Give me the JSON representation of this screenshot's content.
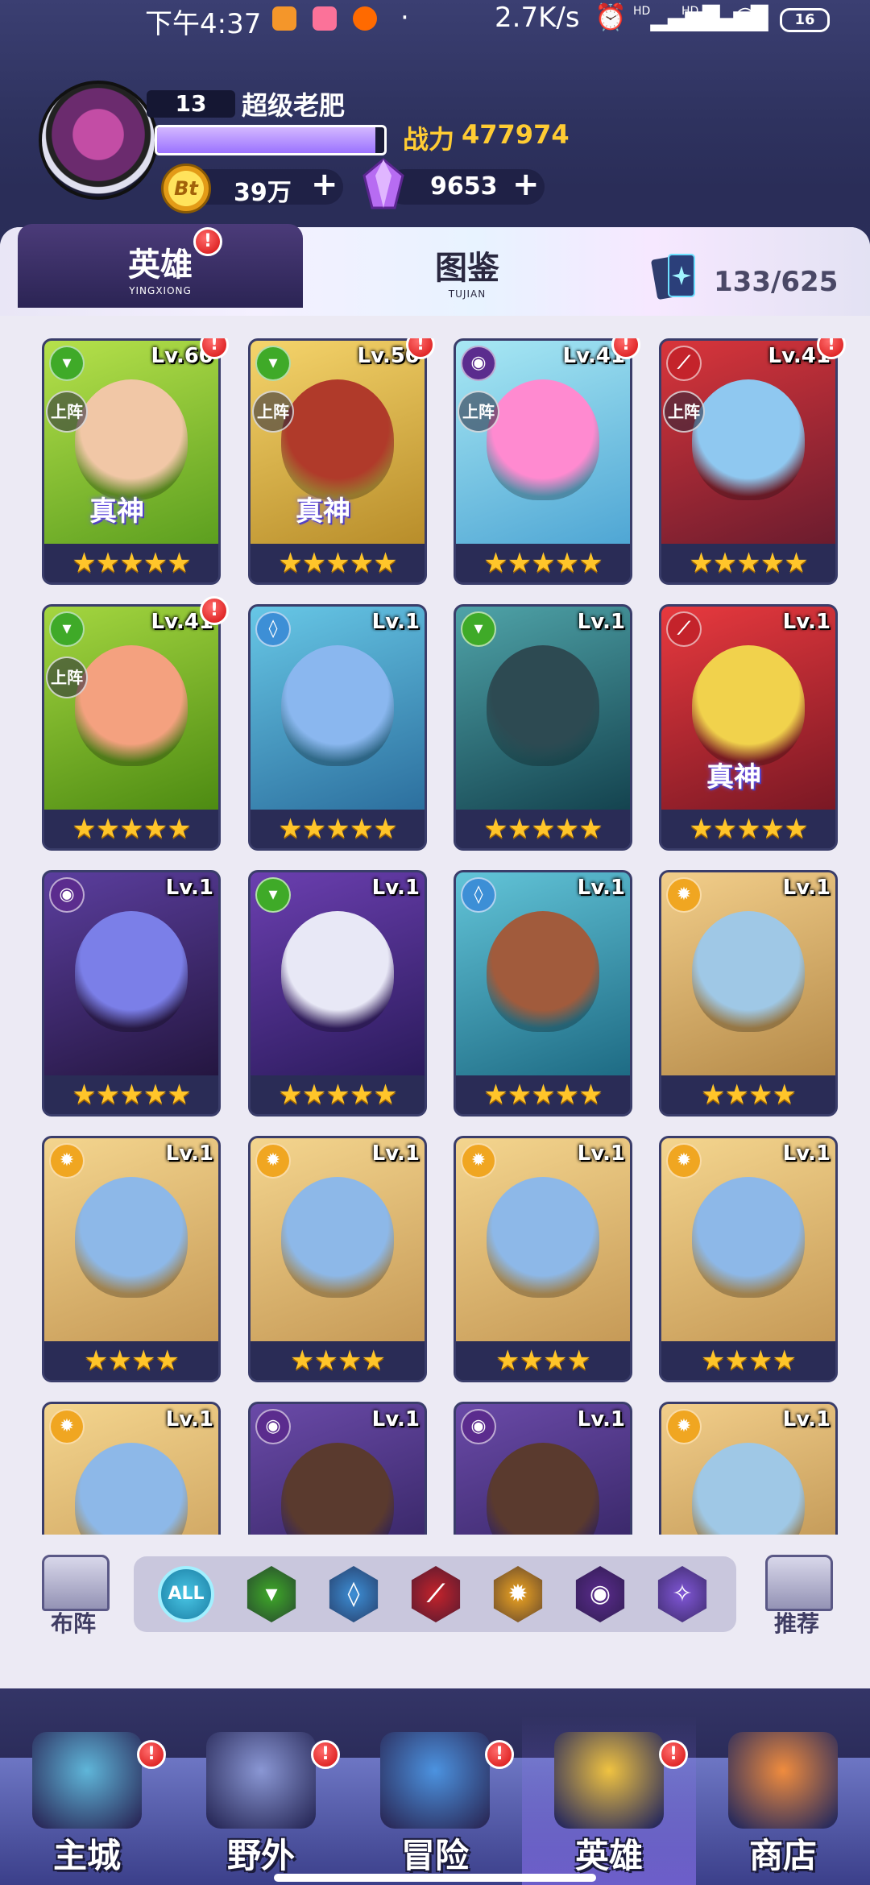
{
  "status_bar": {
    "time": "下午4:37",
    "net_speed": "2.7K/s",
    "signal1": "HD",
    "signal2": "HD",
    "battery": "16"
  },
  "player": {
    "level": "13",
    "name": "超级老肥",
    "xp_fraction": 0.96,
    "power_label": "战力",
    "power_value": "477974",
    "gold": "39万",
    "gold_coin_text": "Bt",
    "gems": "9653",
    "plus": "+"
  },
  "tabs": {
    "heroes": {
      "label": "英雄",
      "sub": "YINGXIONG"
    },
    "codex": {
      "label": "图鉴",
      "sub": "TUJIAN"
    },
    "collection": "133/625",
    "badge": "!"
  },
  "hero_labels": {
    "deployed": "上阵",
    "true_god": "真神"
  },
  "heroes": [
    {
      "level": "Lv.60",
      "stars": "★★★★★",
      "element": "nature",
      "deployed": true,
      "true_god": true,
      "badge": true,
      "colors": [
        "#b6e14b",
        "#5c9f1f"
      ],
      "skin": "#f1c7a6"
    },
    {
      "level": "Lv.50",
      "stars": "★★★★★",
      "element": "nature",
      "deployed": true,
      "true_god": true,
      "badge": true,
      "colors": [
        "#f5d46b",
        "#b88d2a"
      ],
      "skin": "#b03a2a"
    },
    {
      "level": "Lv.41",
      "stars": "★★★★★",
      "element": "dark",
      "deployed": true,
      "true_god": false,
      "badge": true,
      "colors": [
        "#a8e8f4",
        "#4fa6d4"
      ],
      "skin": "#ff8ad0"
    },
    {
      "level": "Lv.41",
      "stars": "★★★★★",
      "element": "fire",
      "deployed": true,
      "true_god": false,
      "badge": true,
      "colors": [
        "#d9353b",
        "#6b1c2e"
      ],
      "skin": "#8fc8f0"
    },
    {
      "level": "Lv.41",
      "stars": "★★★★★",
      "element": "nature",
      "deployed": true,
      "true_god": false,
      "badge": true,
      "colors": [
        "#a4d640",
        "#4d8b12"
      ],
      "skin": "#f4a17f"
    },
    {
      "level": "Lv.1",
      "stars": "★★★★★",
      "element": "water",
      "deployed": false,
      "true_god": false,
      "badge": false,
      "colors": [
        "#67c7e6",
        "#2c6f9e"
      ],
      "skin": "#8ab7ef"
    },
    {
      "level": "Lv.1",
      "stars": "★★★★★",
      "element": "nature",
      "deployed": false,
      "true_god": false,
      "badge": false,
      "colors": [
        "#4fa3a8",
        "#14434f"
      ],
      "skin": "#2d4a52"
    },
    {
      "level": "Lv.1",
      "stars": "★★★★★",
      "element": "fire",
      "deployed": false,
      "true_god": true,
      "badge": false,
      "colors": [
        "#e8393e",
        "#7a1824"
      ],
      "skin": "#f1d24c"
    },
    {
      "level": "Lv.1",
      "stars": "★★★★★",
      "element": "dark",
      "deployed": false,
      "true_god": false,
      "badge": false,
      "colors": [
        "#5b3e9e",
        "#241640"
      ],
      "skin": "#7b7fe8"
    },
    {
      "level": "Lv.1",
      "stars": "★★★★★",
      "element": "nature",
      "deployed": false,
      "true_god": false,
      "badge": false,
      "colors": [
        "#6b3fb0",
        "#2b1b5c"
      ],
      "skin": "#e8e8f6"
    },
    {
      "level": "Lv.1",
      "stars": "★★★★★",
      "element": "water",
      "deployed": false,
      "true_god": false,
      "badge": false,
      "colors": [
        "#62c4d8",
        "#1e6b84"
      ],
      "skin": "#a15b3c"
    },
    {
      "level": "Lv.1",
      "stars": "★★★★",
      "element": "light",
      "deployed": false,
      "true_god": false,
      "badge": false,
      "colors": [
        "#f2ce8a",
        "#b58a49"
      ],
      "skin": "#9fc8e6"
    },
    {
      "level": "Lv.1",
      "stars": "★★★★",
      "element": "light",
      "deployed": false,
      "true_god": false,
      "badge": false,
      "colors": [
        "#f4d58e",
        "#c69a57"
      ],
      "skin": "#8db8e8"
    },
    {
      "level": "Lv.1",
      "stars": "★★★★",
      "element": "light",
      "deployed": false,
      "true_god": false,
      "badge": false,
      "colors": [
        "#f4d58e",
        "#c69a57"
      ],
      "skin": "#8db8e8"
    },
    {
      "level": "Lv.1",
      "stars": "★★★★",
      "element": "light",
      "deployed": false,
      "true_god": false,
      "badge": false,
      "colors": [
        "#f4d58e",
        "#c69a57"
      ],
      "skin": "#8db8e8"
    },
    {
      "level": "Lv.1",
      "stars": "★★★★",
      "element": "light",
      "deployed": false,
      "true_god": false,
      "badge": false,
      "colors": [
        "#f4d58e",
        "#c69a57"
      ],
      "skin": "#8db8e8"
    },
    {
      "level": "Lv.1",
      "stars": "★★★★",
      "element": "light",
      "deployed": false,
      "true_god": false,
      "badge": false,
      "colors": [
        "#f4d58e",
        "#c69a57"
      ],
      "skin": "#8db8e8"
    },
    {
      "level": "Lv.1",
      "stars": "★★★★",
      "element": "dark",
      "deployed": false,
      "true_god": false,
      "badge": false,
      "colors": [
        "#6a4aa8",
        "#2a1d55"
      ],
      "skin": "#5a3a2e"
    },
    {
      "level": "Lv.1",
      "stars": "★★★★",
      "element": "dark",
      "deployed": false,
      "true_god": false,
      "badge": false,
      "colors": [
        "#6a4aa8",
        "#2a1d55"
      ],
      "skin": "#5a3a2e"
    },
    {
      "level": "Lv.1",
      "stars": "★★★★",
      "element": "light",
      "deployed": false,
      "true_god": false,
      "badge": false,
      "colors": [
        "#f2ce8a",
        "#b58a49"
      ],
      "skin": "#9fc8e6"
    }
  ],
  "elements": {
    "nature": {
      "color": "#3faa28",
      "glyph": "▾",
      "icon": "leaf-icon"
    },
    "water": {
      "color": "#3d8fd6",
      "glyph": "◊",
      "icon": "water-drop-icon"
    },
    "fire": {
      "color": "#c4232b",
      "glyph": "⟋",
      "icon": "claw-icon"
    },
    "light": {
      "color": "#f0a621",
      "glyph": "✹",
      "icon": "sun-icon"
    },
    "dark": {
      "color": "#5b2c8e",
      "glyph": "◉",
      "icon": "eye-icon"
    },
    "arcane": {
      "color": "#8157d8",
      "glyph": "✧",
      "icon": "compass-icon"
    }
  },
  "filter_bar": {
    "formation_label": "布阵",
    "recommend_label": "推荐",
    "all_label": "ALL",
    "filters": [
      "nature",
      "water",
      "fire",
      "light",
      "dark",
      "arcane"
    ]
  },
  "nav": [
    {
      "label": "主城",
      "icon": "city-icon",
      "badge": true,
      "color": "#5fb6d9"
    },
    {
      "label": "野外",
      "icon": "wilderness-icon",
      "badge": true,
      "color": "#8a97d4"
    },
    {
      "label": "冒险",
      "icon": "adventure-icon",
      "badge": true,
      "color": "#4c93e0"
    },
    {
      "label": "英雄",
      "icon": "hero-icon",
      "badge": true,
      "color": "#f0c341",
      "active": true
    },
    {
      "label": "商店",
      "icon": "shop-icon",
      "badge": false,
      "color": "#f08c3e"
    }
  ]
}
